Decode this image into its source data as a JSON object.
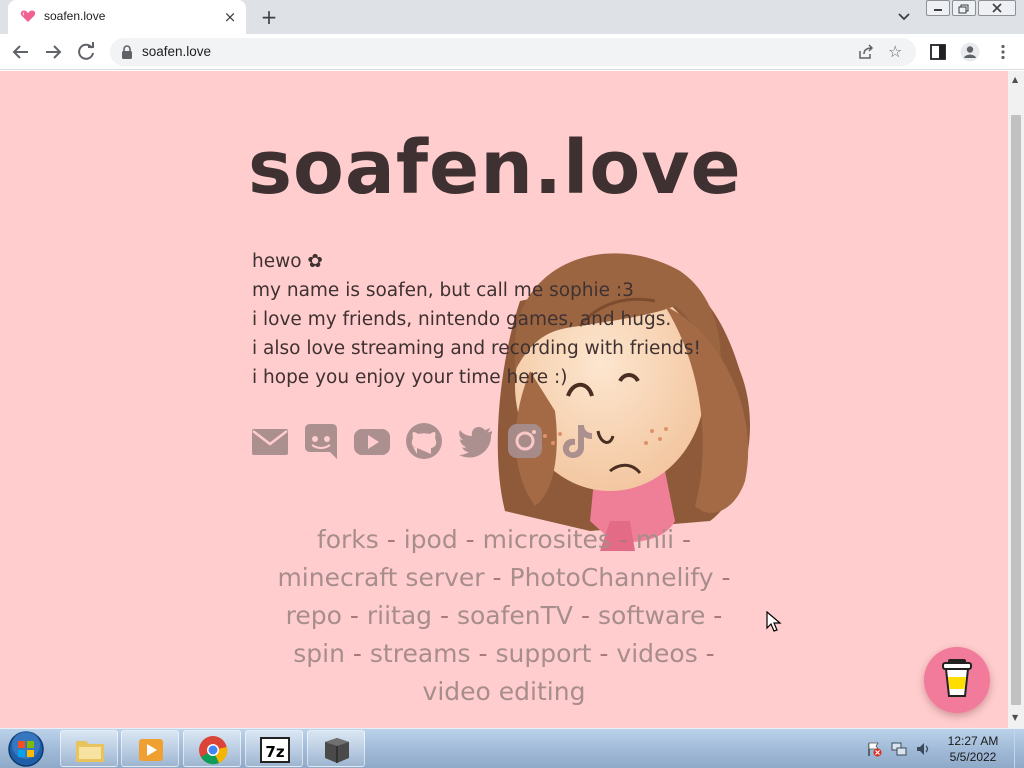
{
  "browser": {
    "tab": {
      "title": "soafen.love",
      "close_icon": "×"
    },
    "newtab_icon": "+",
    "url": "soafen.love"
  },
  "page": {
    "title": "soafen.love",
    "intro_lines": [
      "hewo ✿",
      "my name is soafen, but call me sophie :3",
      "i love my friends, nintendo games, and hugs.",
      "i also love streaming and recording with friends!",
      "i hope you enjoy your time here :)"
    ],
    "socials": [
      "mail-icon",
      "discord-icon",
      "youtube-icon",
      "github-icon",
      "twitter-icon",
      "instagram-icon",
      "tiktok-icon"
    ],
    "link_separator": "-",
    "links": [
      "forks",
      "ipod",
      "microsites",
      "mii",
      "minecraft server",
      "PhotoChannelify",
      "repo",
      "riitag",
      "soafenTV",
      "software",
      "spin",
      "streams",
      "support",
      "videos",
      "video editing"
    ],
    "colors": {
      "background": "#ffcdcd",
      "title": "#3f3131",
      "link": "#a88d8d",
      "coffee_button": "#f27a9b"
    }
  },
  "taskbar": {
    "clock_time": "12:27 AM",
    "clock_date": "5/5/2022"
  }
}
